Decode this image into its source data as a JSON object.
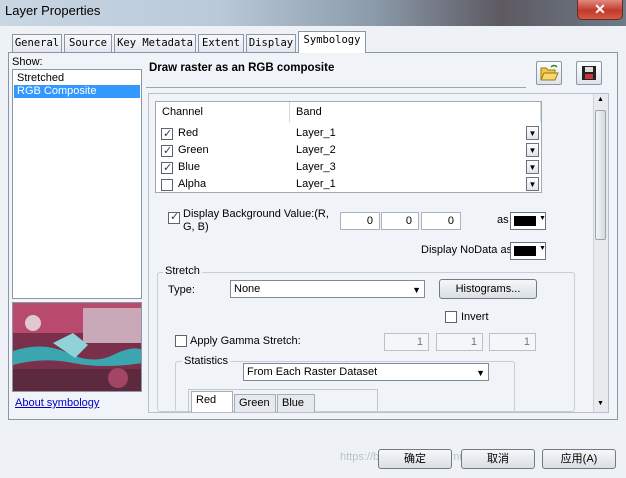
{
  "window": {
    "title": "Layer Properties",
    "close_glyph": "✕"
  },
  "tabs": [
    {
      "label": "General"
    },
    {
      "label": "Source"
    },
    {
      "label": "Key Metadata"
    },
    {
      "label": "Extent"
    },
    {
      "label": "Display"
    },
    {
      "label": "Symbology",
      "active": true
    }
  ],
  "show": {
    "label": "Show:",
    "items": [
      {
        "label": "Stretched"
      },
      {
        "label": "RGB Composite",
        "selected": true
      }
    ]
  },
  "about_link": "About symbology",
  "header": {
    "title": "Draw raster as an RGB composite",
    "open_icon": "folder-open-icon",
    "save_icon": "save-disk-icon"
  },
  "band_grid": {
    "columns": [
      "Channel",
      "Band"
    ],
    "rows": [
      {
        "channel": "Red",
        "band": "Layer_1",
        "checked": true
      },
      {
        "channel": "Green",
        "band": "Layer_2",
        "checked": true
      },
      {
        "channel": "Blue",
        "band": "Layer_3",
        "checked": true
      },
      {
        "channel": "Alpha",
        "band": "Layer_1",
        "checked": false
      }
    ]
  },
  "background": {
    "label": "Display Background Value:(R, G, B)",
    "checked": true,
    "r": "0",
    "g": "0",
    "b": "0",
    "as_label": "as",
    "color": "#000000"
  },
  "nodata": {
    "label": "Display NoData as",
    "color": "#000000"
  },
  "stretch": {
    "group_label": "Stretch",
    "type_label": "Type:",
    "type_value": "None",
    "histograms_label": "Histograms...",
    "invert_label": "Invert",
    "invert_checked": false,
    "gamma_label": "Apply Gamma Stretch:",
    "gamma_checked": false,
    "gamma_values": [
      "1",
      "1",
      "1"
    ]
  },
  "statistics": {
    "group_label": "Statistics",
    "value": "From Each Raster Dataset",
    "tabs": [
      {
        "label": "Red",
        "active": true
      },
      {
        "label": "Green"
      },
      {
        "label": "Blue"
      }
    ]
  },
  "footer": {
    "ok": "确定",
    "cancel": "取消",
    "apply": "应用(A)"
  },
  "watermark": "https://blog.csdn.net/lnmu_lzx"
}
